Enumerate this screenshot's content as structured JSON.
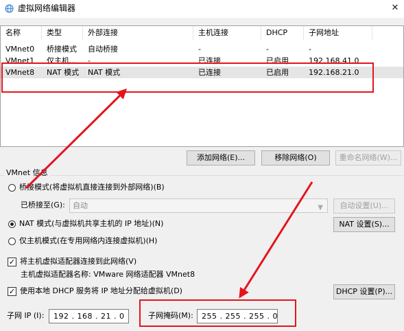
{
  "window": {
    "title": "虚拟网络编辑器",
    "close_glyph": "✕",
    "icon": "globe-network-icon"
  },
  "list": {
    "columns": [
      "名称",
      "类型",
      "外部连接",
      "主机连接",
      "DHCP",
      "子网地址"
    ],
    "rows": [
      {
        "name": "VMnet0",
        "type": "桥接模式",
        "external": "自动桥接",
        "host": "-",
        "dhcp": "-",
        "subnet": "-"
      },
      {
        "name": "VMnet1",
        "type": "仅主机...",
        "external": "-",
        "host": "已连接",
        "dhcp": "已启用",
        "subnet": "192.168.41.0"
      },
      {
        "name": "VMnet8",
        "type": "NAT 模式",
        "external": "NAT 模式",
        "host": "已连接",
        "dhcp": "已启用",
        "subnet": "192.168.21.0"
      }
    ]
  },
  "buttons": {
    "add_network": "添加网络(E)...",
    "remove_network": "移除网络(O)",
    "rename_network": "重命名网络(W)..."
  },
  "vmnet_info": {
    "label": "VMnet 信息",
    "bridged_label": "桥接模式(将虚拟机直接连接到外部网络)(B)",
    "bridged_to_label": "已桥接至(G):",
    "bridged_to_value": "自动",
    "auto_settings": "自动设置(U)...",
    "nat_label": "NAT 模式(与虚拟机共享主机的 IP 地址)(N)",
    "nat_settings": "NAT 设置(S)...",
    "host_only_label": "仅主机模式(在专用网络内连接虚拟机)(H)",
    "connect_adapter_label": "将主机虚拟适配器连接到此网络(V)",
    "adapter_name_text": "主机虚拟适配器名称: VMware 网络适配器 VMnet8",
    "dhcp_label": "使用本地 DHCP 服务将 IP 地址分配给虚拟机(D)",
    "dhcp_settings": "DHCP 设置(P)...",
    "subnet_ip_label": "子网 IP (I):",
    "subnet_ip_value": "192 . 168 . 21 . 0",
    "subnet_mask_label": "子网掩码(M):",
    "subnet_mask_value": "255 . 255 . 255 . 0",
    "selected_mode": "nat",
    "connect_adapter_checked": true,
    "dhcp_checked": true
  },
  "annotations": {
    "color": "#e4141c"
  }
}
